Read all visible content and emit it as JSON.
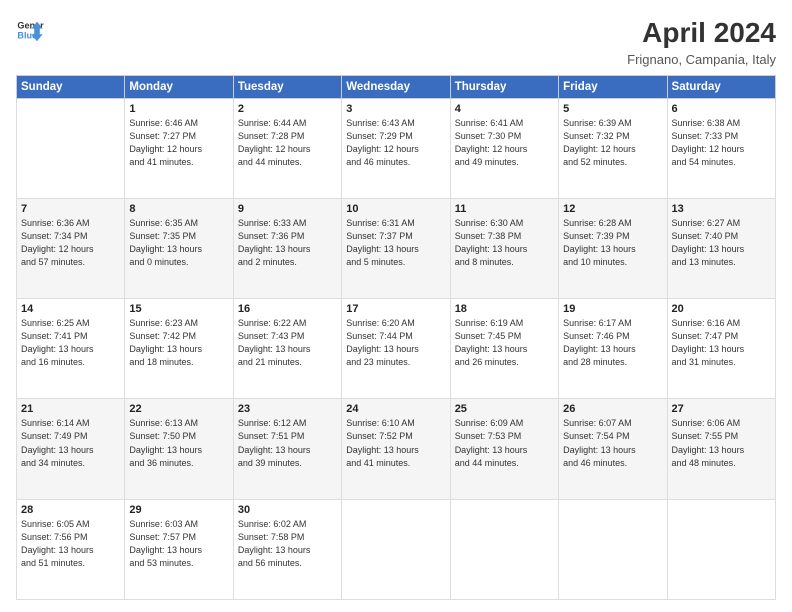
{
  "header": {
    "logo_line1": "General",
    "logo_line2": "Blue",
    "title": "April 2024",
    "subtitle": "Frignano, Campania, Italy"
  },
  "weekdays": [
    "Sunday",
    "Monday",
    "Tuesday",
    "Wednesday",
    "Thursday",
    "Friday",
    "Saturday"
  ],
  "weeks": [
    [
      {
        "day": "",
        "info": ""
      },
      {
        "day": "1",
        "info": "Sunrise: 6:46 AM\nSunset: 7:27 PM\nDaylight: 12 hours\nand 41 minutes."
      },
      {
        "day": "2",
        "info": "Sunrise: 6:44 AM\nSunset: 7:28 PM\nDaylight: 12 hours\nand 44 minutes."
      },
      {
        "day": "3",
        "info": "Sunrise: 6:43 AM\nSunset: 7:29 PM\nDaylight: 12 hours\nand 46 minutes."
      },
      {
        "day": "4",
        "info": "Sunrise: 6:41 AM\nSunset: 7:30 PM\nDaylight: 12 hours\nand 49 minutes."
      },
      {
        "day": "5",
        "info": "Sunrise: 6:39 AM\nSunset: 7:32 PM\nDaylight: 12 hours\nand 52 minutes."
      },
      {
        "day": "6",
        "info": "Sunrise: 6:38 AM\nSunset: 7:33 PM\nDaylight: 12 hours\nand 54 minutes."
      }
    ],
    [
      {
        "day": "7",
        "info": "Sunrise: 6:36 AM\nSunset: 7:34 PM\nDaylight: 12 hours\nand 57 minutes."
      },
      {
        "day": "8",
        "info": "Sunrise: 6:35 AM\nSunset: 7:35 PM\nDaylight: 13 hours\nand 0 minutes."
      },
      {
        "day": "9",
        "info": "Sunrise: 6:33 AM\nSunset: 7:36 PM\nDaylight: 13 hours\nand 2 minutes."
      },
      {
        "day": "10",
        "info": "Sunrise: 6:31 AM\nSunset: 7:37 PM\nDaylight: 13 hours\nand 5 minutes."
      },
      {
        "day": "11",
        "info": "Sunrise: 6:30 AM\nSunset: 7:38 PM\nDaylight: 13 hours\nand 8 minutes."
      },
      {
        "day": "12",
        "info": "Sunrise: 6:28 AM\nSunset: 7:39 PM\nDaylight: 13 hours\nand 10 minutes."
      },
      {
        "day": "13",
        "info": "Sunrise: 6:27 AM\nSunset: 7:40 PM\nDaylight: 13 hours\nand 13 minutes."
      }
    ],
    [
      {
        "day": "14",
        "info": "Sunrise: 6:25 AM\nSunset: 7:41 PM\nDaylight: 13 hours\nand 16 minutes."
      },
      {
        "day": "15",
        "info": "Sunrise: 6:23 AM\nSunset: 7:42 PM\nDaylight: 13 hours\nand 18 minutes."
      },
      {
        "day": "16",
        "info": "Sunrise: 6:22 AM\nSunset: 7:43 PM\nDaylight: 13 hours\nand 21 minutes."
      },
      {
        "day": "17",
        "info": "Sunrise: 6:20 AM\nSunset: 7:44 PM\nDaylight: 13 hours\nand 23 minutes."
      },
      {
        "day": "18",
        "info": "Sunrise: 6:19 AM\nSunset: 7:45 PM\nDaylight: 13 hours\nand 26 minutes."
      },
      {
        "day": "19",
        "info": "Sunrise: 6:17 AM\nSunset: 7:46 PM\nDaylight: 13 hours\nand 28 minutes."
      },
      {
        "day": "20",
        "info": "Sunrise: 6:16 AM\nSunset: 7:47 PM\nDaylight: 13 hours\nand 31 minutes."
      }
    ],
    [
      {
        "day": "21",
        "info": "Sunrise: 6:14 AM\nSunset: 7:49 PM\nDaylight: 13 hours\nand 34 minutes."
      },
      {
        "day": "22",
        "info": "Sunrise: 6:13 AM\nSunset: 7:50 PM\nDaylight: 13 hours\nand 36 minutes."
      },
      {
        "day": "23",
        "info": "Sunrise: 6:12 AM\nSunset: 7:51 PM\nDaylight: 13 hours\nand 39 minutes."
      },
      {
        "day": "24",
        "info": "Sunrise: 6:10 AM\nSunset: 7:52 PM\nDaylight: 13 hours\nand 41 minutes."
      },
      {
        "day": "25",
        "info": "Sunrise: 6:09 AM\nSunset: 7:53 PM\nDaylight: 13 hours\nand 44 minutes."
      },
      {
        "day": "26",
        "info": "Sunrise: 6:07 AM\nSunset: 7:54 PM\nDaylight: 13 hours\nand 46 minutes."
      },
      {
        "day": "27",
        "info": "Sunrise: 6:06 AM\nSunset: 7:55 PM\nDaylight: 13 hours\nand 48 minutes."
      }
    ],
    [
      {
        "day": "28",
        "info": "Sunrise: 6:05 AM\nSunset: 7:56 PM\nDaylight: 13 hours\nand 51 minutes."
      },
      {
        "day": "29",
        "info": "Sunrise: 6:03 AM\nSunset: 7:57 PM\nDaylight: 13 hours\nand 53 minutes."
      },
      {
        "day": "30",
        "info": "Sunrise: 6:02 AM\nSunset: 7:58 PM\nDaylight: 13 hours\nand 56 minutes."
      },
      {
        "day": "",
        "info": ""
      },
      {
        "day": "",
        "info": ""
      },
      {
        "day": "",
        "info": ""
      },
      {
        "day": "",
        "info": ""
      }
    ]
  ]
}
